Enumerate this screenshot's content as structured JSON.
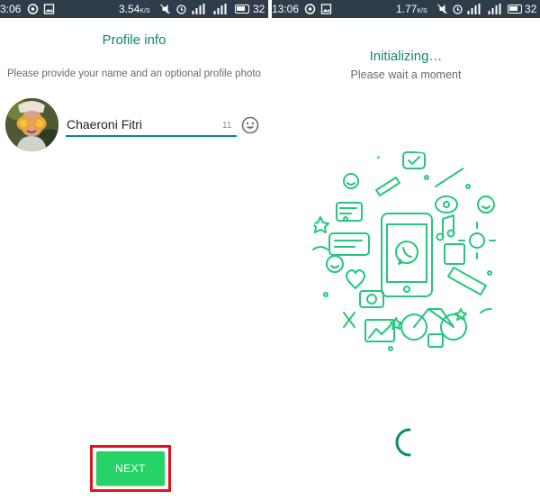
{
  "left": {
    "status": {
      "time": "3:06",
      "network_speed": "3.54",
      "speed_unit": "K/S",
      "battery": "32"
    },
    "title": "Profile info",
    "subtitle": "Please provide your name and an optional profile photo",
    "name_input": {
      "value": "Chaeroni Fitri"
    },
    "char_count": "11",
    "next_label": "NEXT"
  },
  "right": {
    "status": {
      "time": "13:06",
      "network_speed": "1.77",
      "speed_unit": "K/S",
      "battery": "32"
    },
    "title": "Initializing…",
    "subtitle": "Please wait a moment"
  },
  "colors": {
    "accent": "#0c8a6e",
    "button": "#25d366",
    "highlight": "#e0141e",
    "statusbar": "#2f3d4a",
    "doodle": "#25c77a"
  },
  "icons": [
    "whatsapp-icon",
    "image-icon",
    "silent-icon",
    "alarm-icon",
    "signal-icon",
    "battery-icon",
    "emoji-icon"
  ]
}
